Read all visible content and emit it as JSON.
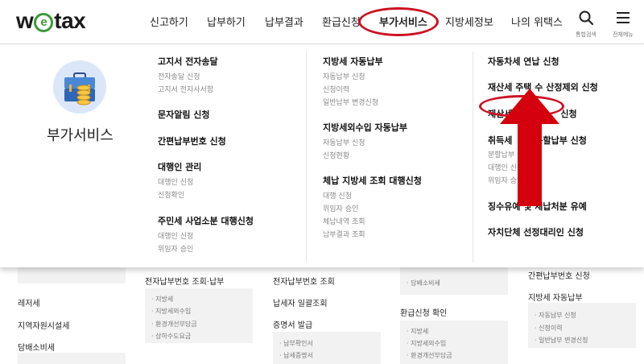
{
  "header": {
    "logo_left": "w",
    "logo_mid": "e",
    "logo_right": "tax",
    "nav": [
      "신고하기",
      "납부하기",
      "납부결과",
      "환급신청",
      "부가서비스",
      "지방세정보",
      "나의 위택스"
    ],
    "search_label": "통합검색",
    "all_menu_label": "전체메뉴"
  },
  "mega": {
    "title": "부가서비스",
    "col1": {
      "g1_head": "고지서 전자송달",
      "g1_sub1": "전자송달 신청",
      "g1_sub2": "고지서 전자사서함",
      "g2_head": "문자알림 신청",
      "g3_head": "간편납부번호 신청",
      "g4_head": "대행인 관리",
      "g4_sub1": "대행인 신청",
      "g4_sub2": "신청확인",
      "g5_head": "주민세 사업소분 대행신청",
      "g5_sub1": "대행인 신청",
      "g5_sub2": "위임자 승인"
    },
    "col2": {
      "g1_head": "지방세 자동납부",
      "g1_sub1": "자동납부 신청",
      "g1_sub2": "신청이력",
      "g1_sub3": "일반납부 변경신청",
      "g2_head": "지방세외수입 자동납부",
      "g2_sub1": "자동납부 신청",
      "g2_sub2": "신청현황",
      "g3_head": "체납 지방세 조회 대행신청",
      "g3_sub1": "대행 신청",
      "g3_sub2": "위임자 승인",
      "g3_sub3": "체납내역 조회",
      "g3_sub4": "납부결과 조회"
    },
    "col3": {
      "g1_head": "자동차세 연납 신청",
      "g2_head": "재산세 주택 수 산정제외 신청",
      "g3_head_a": "재산세",
      "g3_head_b": "신청",
      "g4_head_a": "취득세",
      "g4_head_b": "분할납부 신청",
      "g4_sub1": "분할납부 신청",
      "g4_sub2": "대행인 신청",
      "g4_sub3": "위임자 승인",
      "g5_head": "징수유예 및 체납처분 유예",
      "g6_head": "자치단체 선정대리인 신청"
    }
  },
  "background": {
    "c0_item1": "레저세",
    "c0_item2": "지역자원시설세",
    "c0_item3": "담배소비세",
    "c1_head": "전자납부번호 조회·납부",
    "c1_sub1": "지방세",
    "c1_sub2": "지방세외수입",
    "c1_sub3": "환경개선부담금",
    "c1_sub4": "상하수도요금",
    "c2_item1": "전자납부번호 조회",
    "c2_item2": "납세자 일괄조회",
    "c2_head3": "증명서 발급",
    "c2_sub1": "납부확인서",
    "c2_sub2": "납세증명서",
    "c3_sub0": "담배소비세",
    "c3_head": "환급신청 확인",
    "c3_sub1": "지방세",
    "c3_sub2": "지방세외수입",
    "c3_sub3": "환경개선부담금",
    "c4_item1": "간편납부번호 신청",
    "c4_head": "지방세 자동납부",
    "c4_sub1": "자동납부 신청",
    "c4_sub2": "신청이력",
    "c4_sub3": "일반납부 변경신청"
  },
  "colors": {
    "annotation_red": "#cc1122",
    "icon_circle": "#dbe7f9",
    "logo_green": "#3a9a3a"
  }
}
